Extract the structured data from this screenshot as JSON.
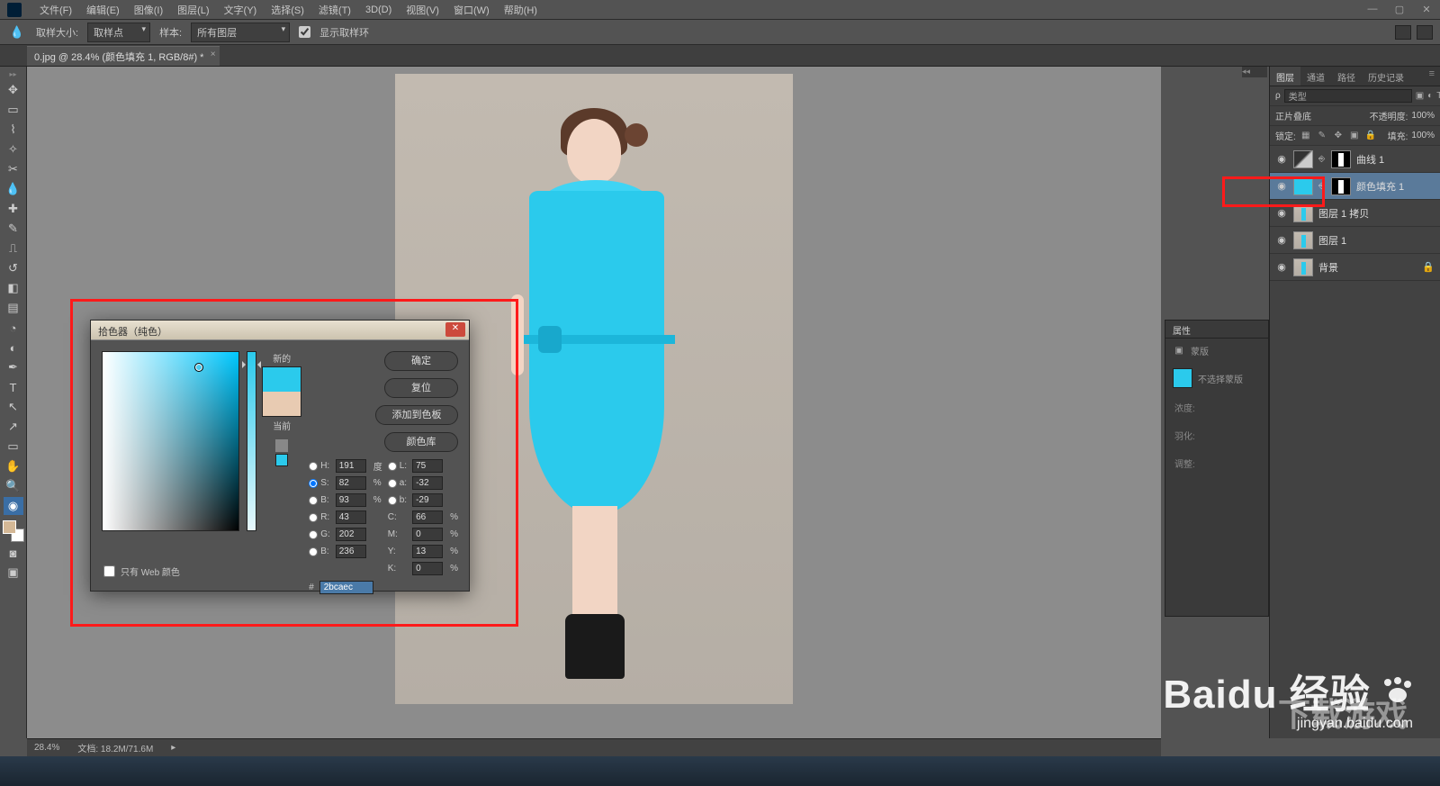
{
  "menu": {
    "items": [
      "文件(F)",
      "编辑(E)",
      "图像(I)",
      "图层(L)",
      "文字(Y)",
      "选择(S)",
      "滤镜(T)",
      "3D(D)",
      "视图(V)",
      "窗口(W)",
      "帮助(H)"
    ]
  },
  "optbar": {
    "sample_size_label": "取样大小:",
    "sample_size_value": "取样点",
    "sample_label": "样本:",
    "sample_value": "所有图层",
    "show_ring_label": "显示取样环"
  },
  "tab": {
    "title": "0.jpg @ 28.4% (颜色填充 1, RGB/8#) *"
  },
  "colorpicker": {
    "title": "拾色器（纯色）",
    "new_label": "新的",
    "current_label": "当前",
    "ok": "确定",
    "reset": "复位",
    "add_swatch": "添加到色板",
    "libraries": "颜色库",
    "web_only": "只有 Web 颜色",
    "fields": {
      "H_label": "H:",
      "H": "191",
      "H_unit": "度",
      "S_label": "S:",
      "S": "82",
      "S_unit": "%",
      "Bri_label": "B:",
      "Bri": "93",
      "Bri_unit": "%",
      "R_label": "R:",
      "R": "43",
      "G_label": "G:",
      "G": "202",
      "B_label": "B:",
      "B": "236",
      "L_label": "L:",
      "L": "75",
      "a_label": "a:",
      "a": "-32",
      "b_label": "b:",
      "b": "-29",
      "C_label": "C:",
      "C": "66",
      "pct": "%",
      "M_label": "M:",
      "M": "0",
      "Y_label": "Y:",
      "Y": "13",
      "K_label": "K:",
      "K": "0",
      "hex_label": "#",
      "hex": "2bcaec"
    }
  },
  "layers_panel": {
    "tabs": [
      "图层",
      "通道",
      "路径",
      "历史记录"
    ],
    "type_filter": "类型",
    "blend_mode": "正片叠底",
    "opacity_label": "不透明度:",
    "opacity_value": "100%",
    "lock_label": "锁定:",
    "fill_label": "填充:",
    "fill_value": "100%",
    "layers": [
      {
        "name": "曲线 1"
      },
      {
        "name": "颜色填充 1"
      },
      {
        "name": "图层 1 拷贝"
      },
      {
        "name": "图层 1"
      },
      {
        "name": "背景"
      }
    ]
  },
  "properties": {
    "title": "属性",
    "mask_label": "蒙版",
    "no_sel": "不选择蒙版",
    "density": "浓度:",
    "feather": "羽化:",
    "refine": "调整:"
  },
  "status": {
    "zoom": "28.4%",
    "doc": "文档: 18.2M/71.6M"
  },
  "watermark": {
    "main": "Baidu 经验",
    "sub": "jingyan.baidu.com",
    "alt": "下载游戏"
  }
}
